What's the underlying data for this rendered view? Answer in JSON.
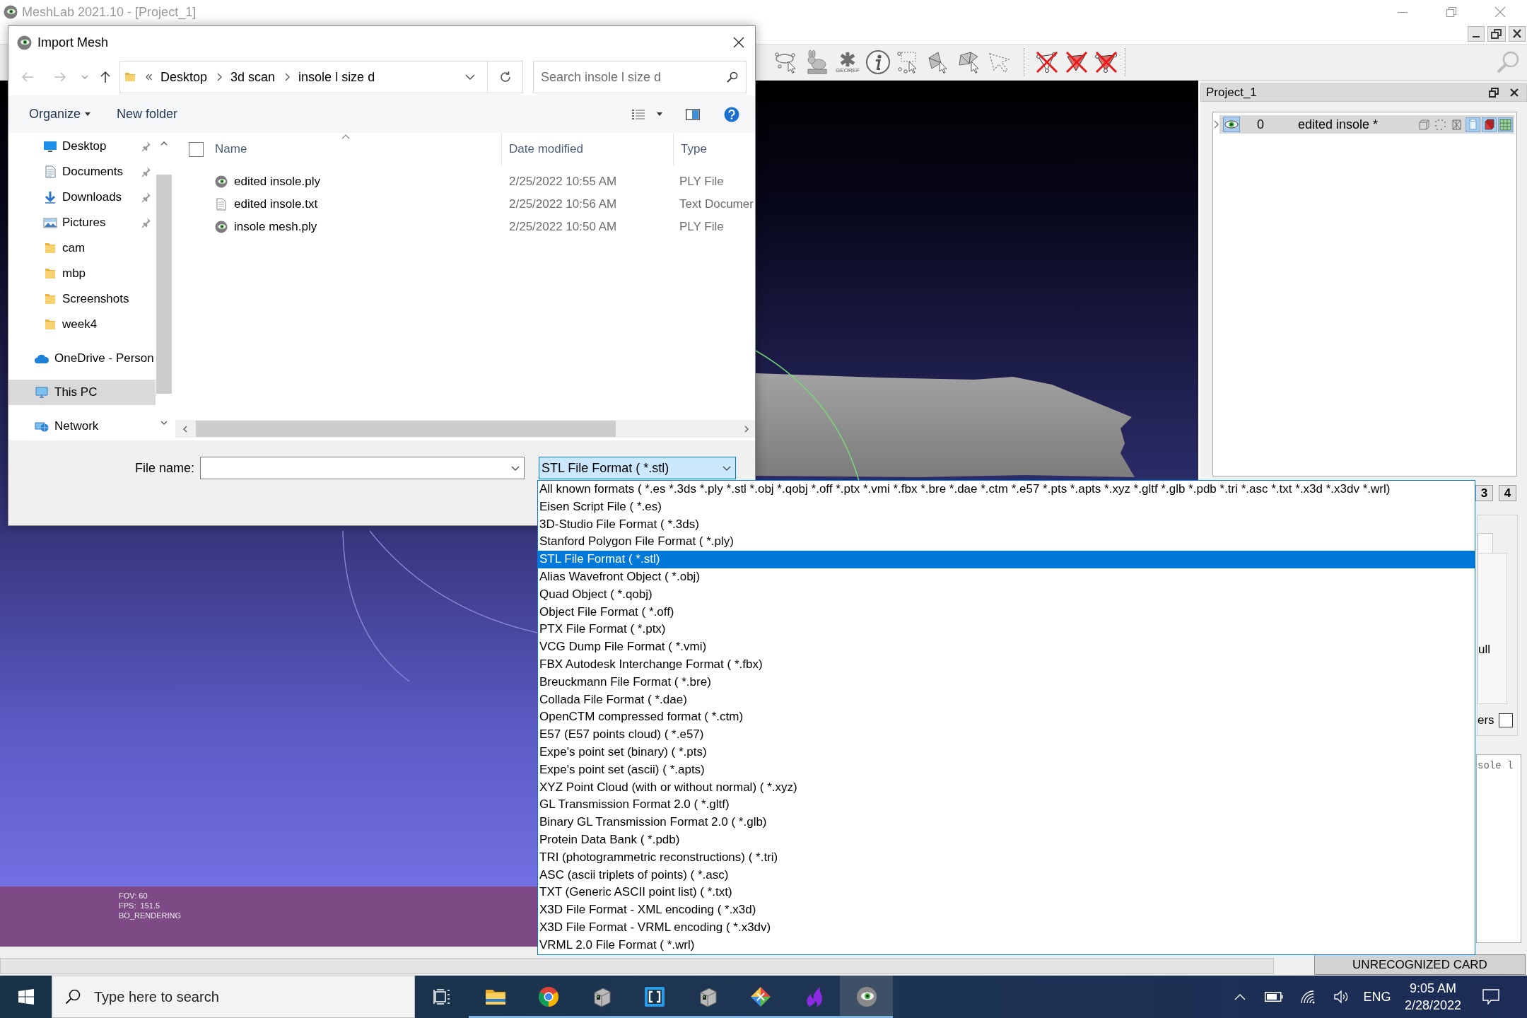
{
  "app": {
    "title": "MeshLab 2021.10 - [Project_1]",
    "georef_label": "GEOREF"
  },
  "viewport": {
    "info_lines": [
      "FOV: 60",
      "FPS:  151.5",
      "BO_RENDERING"
    ]
  },
  "project_panel": {
    "title": "Project_1",
    "layers": [
      {
        "index": "0",
        "name": "edited insole *",
        "visible": true,
        "expanded": false,
        "selected": true,
        "render_modes": [
          {
            "kind": "box",
            "on": false
          },
          {
            "kind": "points",
            "on": false
          },
          {
            "kind": "wire",
            "on": false
          },
          {
            "kind": "smooth",
            "on": true
          },
          {
            "kind": "color",
            "on": true
          },
          {
            "kind": "texture",
            "on": true
          }
        ]
      }
    ],
    "view_buttons": [
      "3",
      "4"
    ],
    "tab_fragment": "ull",
    "option": {
      "label": "ers",
      "checked": false
    },
    "log_fragment": "sole l"
  },
  "status_bar": {
    "card_label": "UNRECOGNIZED CARD"
  },
  "dialog": {
    "title": "Import Mesh",
    "back_disabled": true,
    "forward_disabled": true,
    "breadcrumb": [
      "Desktop",
      "3d scan",
      "insole l size d"
    ],
    "search": {
      "placeholder": "Search insole l size d"
    },
    "commands": [
      {
        "label": "Organize",
        "kind": "menu"
      },
      {
        "label": "New folder",
        "kind": "action"
      }
    ],
    "quick_access": [
      {
        "label": "Desktop",
        "kind": "desktop",
        "pinned": true,
        "selected": false
      },
      {
        "label": "Documents",
        "kind": "documents",
        "pinned": true,
        "selected": false
      },
      {
        "label": "Downloads",
        "kind": "downloads",
        "pinned": true,
        "selected": false
      },
      {
        "label": "Pictures",
        "kind": "pictures",
        "pinned": true,
        "selected": false
      },
      {
        "label": "cam",
        "kind": "folder",
        "pinned": false,
        "selected": false
      },
      {
        "label": "mbp",
        "kind": "folder",
        "pinned": false,
        "selected": false
      },
      {
        "label": "Screenshots",
        "kind": "folder",
        "pinned": false,
        "selected": false
      },
      {
        "label": "week4",
        "kind": "folder",
        "pinned": false,
        "selected": false
      }
    ],
    "locations": [
      {
        "label": "OneDrive - Person",
        "kind": "cloud",
        "selected": false
      },
      {
        "label": "This PC",
        "kind": "pc",
        "selected": true
      },
      {
        "label": "Network",
        "kind": "network",
        "selected": false
      }
    ],
    "select_all_checked": false,
    "columns": [
      "Name",
      "Date modified",
      "Type"
    ],
    "files": [
      {
        "name": "edited insole.ply",
        "modified": "2/25/2022 10:55 AM",
        "type": "PLY File",
        "kind": "mesh",
        "selected": false
      },
      {
        "name": "edited insole.txt",
        "modified": "2/25/2022 10:56 AM",
        "type": "Text Documer",
        "kind": "text",
        "selected": false
      },
      {
        "name": "insole mesh.ply",
        "modified": "2/25/2022 10:50 AM",
        "type": "PLY File",
        "kind": "mesh",
        "selected": false
      }
    ],
    "file_name_label": "File name:",
    "file_type": "STL File Format ( *.stl)",
    "file_types": [
      {
        "label": "All known formats ( *.es *.3ds *.ply *.stl *.obj *.qobj *.off *.ptx *.vmi *.fbx *.bre *.dae *.ctm *.e57 *.pts *.apts *.xyz *.gltf *.glb *.pdb *.tri *.asc *.txt *.x3d *.x3dv *.wrl)",
        "selected": false
      },
      {
        "label": "Eisen Script File ( *.es)",
        "selected": false
      },
      {
        "label": "3D-Studio File Format ( *.3ds)",
        "selected": false
      },
      {
        "label": "Stanford Polygon File Format ( *.ply)",
        "selected": false
      },
      {
        "label": "STL File Format ( *.stl)",
        "selected": true
      },
      {
        "label": "Alias Wavefront Object ( *.obj)",
        "selected": false
      },
      {
        "label": "Quad Object ( *.qobj)",
        "selected": false
      },
      {
        "label": "Object File Format ( *.off)",
        "selected": false
      },
      {
        "label": "PTX File Format ( *.ptx)",
        "selected": false
      },
      {
        "label": "VCG Dump File Format ( *.vmi)",
        "selected": false
      },
      {
        "label": "FBX Autodesk Interchange Format ( *.fbx)",
        "selected": false
      },
      {
        "label": "Breuckmann File Format ( *.bre)",
        "selected": false
      },
      {
        "label": "Collada File Format ( *.dae)",
        "selected": false
      },
      {
        "label": "OpenCTM compressed format ( *.ctm)",
        "selected": false
      },
      {
        "label": "E57 (E57 points cloud) ( *.e57)",
        "selected": false
      },
      {
        "label": "Expe's point set (binary) ( *.pts)",
        "selected": false
      },
      {
        "label": "Expe's point set (ascii) ( *.apts)",
        "selected": false
      },
      {
        "label": "XYZ Point Cloud (with or without normal) ( *.xyz)",
        "selected": false
      },
      {
        "label": "GL Transmission Format 2.0 ( *.gltf)",
        "selected": false
      },
      {
        "label": "Binary GL Transmission Format 2.0 ( *.glb)",
        "selected": false
      },
      {
        "label": "Protein Data Bank ( *.pdb)",
        "selected": false
      },
      {
        "label": "TRI (photogrammetric reconstructions) ( *.tri)",
        "selected": false
      },
      {
        "label": "ASC (ascii triplets of points) ( *.asc)",
        "selected": false
      },
      {
        "label": "TXT (Generic ASCII point list) ( *.txt)",
        "selected": false
      },
      {
        "label": "X3D File Format - XML encoding ( *.x3d)",
        "selected": false
      },
      {
        "label": "X3D File Format - VRML encoding ( *.x3dv)",
        "selected": false
      },
      {
        "label": "VRML 2.0 File Format ( *.wrl)",
        "selected": false
      }
    ]
  },
  "taskbar": {
    "search_placeholder": "Type here to search",
    "apps": [
      {
        "kind": "explorer",
        "running": true,
        "active": false
      },
      {
        "kind": "chrome",
        "running": true,
        "active": false
      },
      {
        "kind": "machine",
        "running": true,
        "active": false
      },
      {
        "kind": "brackets",
        "running": true,
        "active": false
      },
      {
        "kind": "machine",
        "running": true,
        "active": false
      },
      {
        "kind": "diamond",
        "running": true,
        "active": false
      },
      {
        "kind": "flame",
        "running": true,
        "active": false
      },
      {
        "kind": "meshlab",
        "running": true,
        "active": true
      }
    ],
    "language": "ENG",
    "time": "9:05 AM",
    "date": "2/28/2022"
  }
}
